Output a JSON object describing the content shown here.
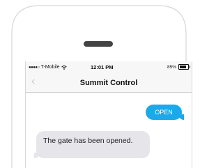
{
  "status_bar": {
    "signal": "●●●●○",
    "carrier": "T-Mobile",
    "wifi_icon": "wifi-icon",
    "time": "12:01 PM",
    "battery_percent": "85%",
    "battery_level": 0.85
  },
  "nav": {
    "back_icon": "chevron-left-icon",
    "back_glyph": "‹",
    "title": "Summit Control"
  },
  "messages": [
    {
      "direction": "outgoing",
      "text": "OPEN",
      "color": "#1ba9ea"
    },
    {
      "direction": "incoming",
      "text": "The gate has been opened.",
      "color": "#e5e5ea"
    }
  ]
}
